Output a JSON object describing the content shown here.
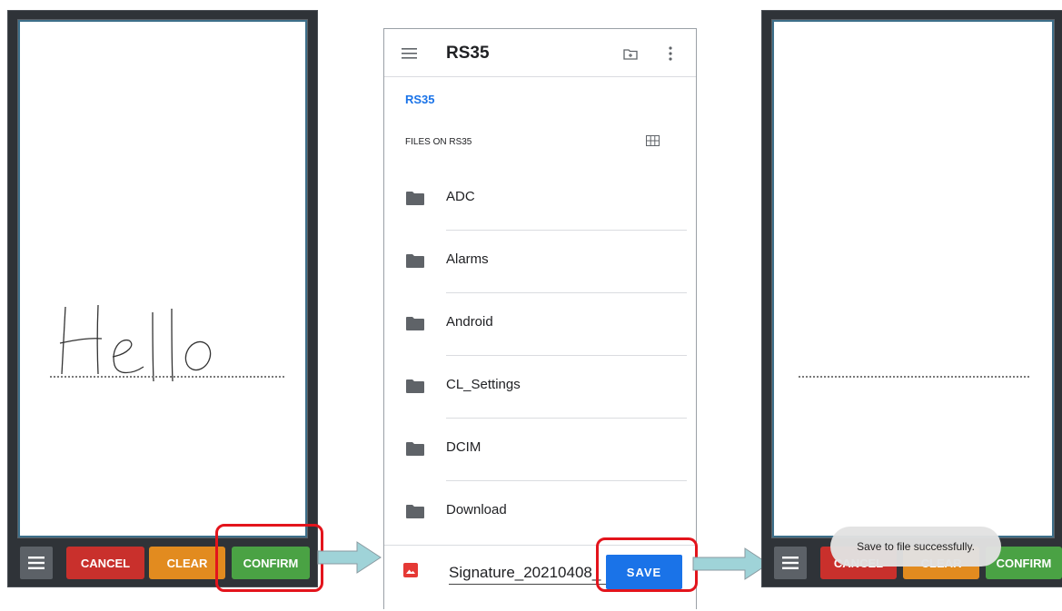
{
  "left_panel": {
    "signature_text": "Hello",
    "buttons": {
      "cancel": "CANCEL",
      "clear": "CLEAR",
      "confirm": "CONFIRM"
    },
    "menu_icon": "hamburger-icon"
  },
  "file_picker": {
    "title": "RS35",
    "breadcrumb": "RS35",
    "section_label": "FILES ON RS35",
    "icons": {
      "menu": "hamburger-icon",
      "new_folder": "new-folder-icon",
      "overflow": "more-vert-icon",
      "grid": "grid-view-icon"
    },
    "folders": [
      {
        "name": "ADC"
      },
      {
        "name": "Alarms"
      },
      {
        "name": "Android"
      },
      {
        "name": "CL_Settings"
      },
      {
        "name": "DCIM"
      },
      {
        "name": "Download"
      }
    ],
    "filename_value": "Signature_20210408_",
    "save_label": "SAVE"
  },
  "right_panel": {
    "buttons": {
      "cancel": "CANCEL",
      "clear": "CLEAR",
      "confirm": "CONFIRM"
    },
    "toast": "Save to file successfully."
  },
  "colors": {
    "cancel": "#c9302c",
    "clear": "#e28b1f",
    "confirm": "#4aa244",
    "highlight": "#e3141c",
    "accent": "#1a73e8",
    "arrow": "#9fd3d8"
  }
}
